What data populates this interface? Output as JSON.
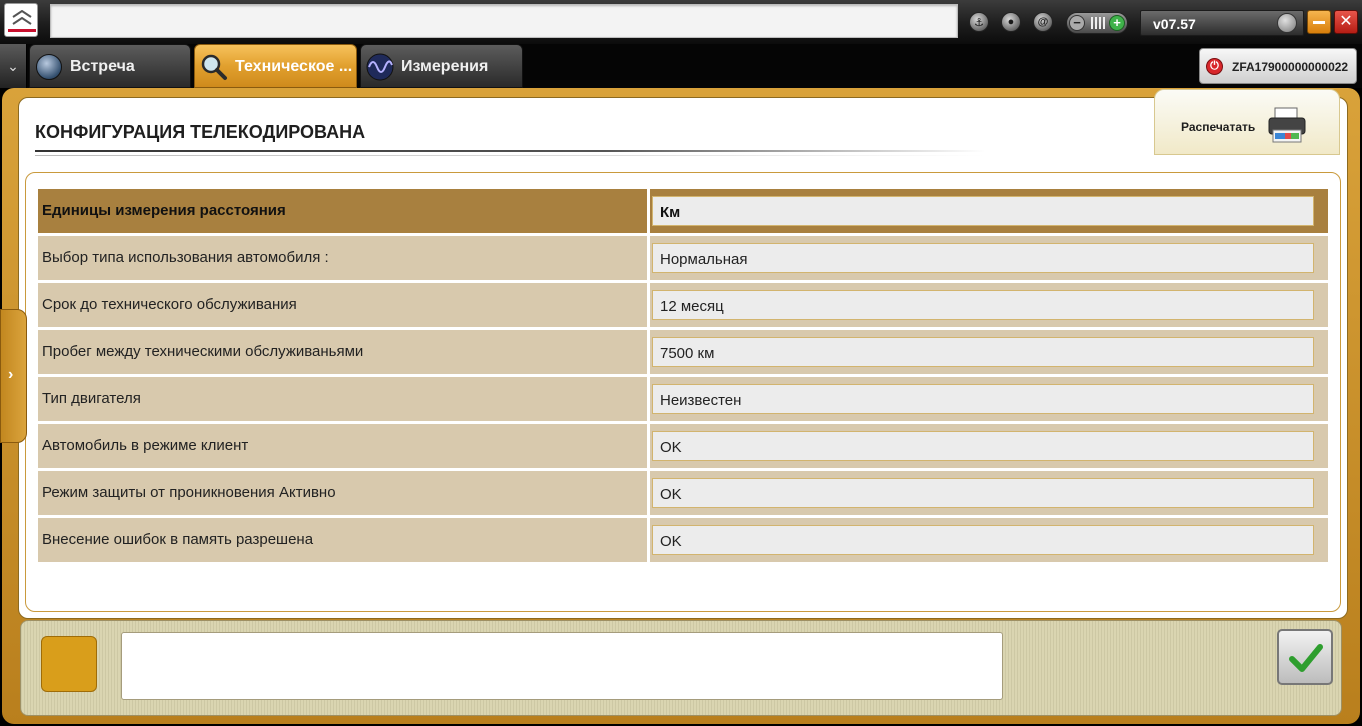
{
  "window": {
    "version": "v07.57",
    "address": ""
  },
  "tabs": [
    {
      "label": "Встреча",
      "icon": "dashboard-icon",
      "active": false
    },
    {
      "label": "Техническое ...",
      "icon": "magnifier-icon",
      "active": true
    },
    {
      "label": "Измерения",
      "icon": "waveform-icon",
      "active": false
    }
  ],
  "vehicle": {
    "vin": "ZFA17900000000022"
  },
  "page": {
    "title": "КОНФИГУРАЦИЯ ТЕЛЕКОДИРОВАНА",
    "print_label": "Распечатать"
  },
  "table": {
    "header": {
      "key": "Единицы измерения расстояния",
      "value": "Км"
    },
    "rows": [
      {
        "key": "Выбор типа использования автомобиля :",
        "value": "Нормальная"
      },
      {
        "key": "Срок до технического обслуживания",
        "value": "12 месяц"
      },
      {
        "key": "Пробег между техническими обслуживаньями",
        "value": "7500 км"
      },
      {
        "key": "Тип двигателя",
        "value": "Неизвестен"
      },
      {
        "key": "Автомобиль в режиме клиент",
        "value": "OK"
      },
      {
        "key": "Режим защиты от проникновения Активно",
        "value": "OK"
      },
      {
        "key": "Внесение ошибок в память разрешена",
        "value": "OK"
      }
    ]
  },
  "footer": {
    "message": ""
  },
  "colors": {
    "accent": "#dba43d",
    "header_row": "#a8803f",
    "row": "#d8c9ad",
    "close": "#c7261b",
    "ok_check": "#2e9e2e"
  }
}
